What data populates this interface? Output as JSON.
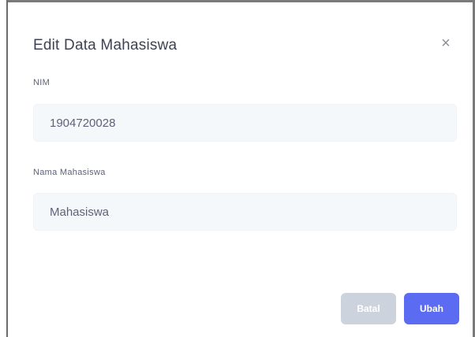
{
  "modal": {
    "title": "Edit Data Mahasiswa",
    "close_symbol": "×",
    "close_icon": "close-icon"
  },
  "fields": {
    "nim": {
      "label": "NIM",
      "value": "1904720028"
    },
    "nama": {
      "label": "Nama Mahasiswa",
      "value": "Mahasiswa"
    }
  },
  "actions": {
    "cancel_label": "Batal",
    "submit_label": "Ubah"
  },
  "colors": {
    "primary": "#5b6cf2",
    "cancel": "#cdd3dd",
    "input_bg": "#f5f8fa"
  }
}
